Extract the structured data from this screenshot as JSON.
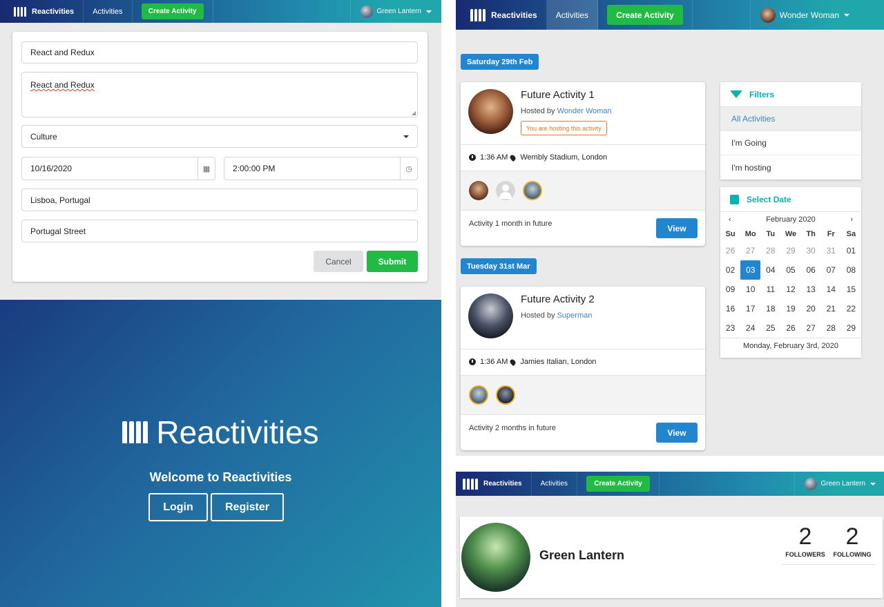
{
  "form_panel": {
    "nav": {
      "brand": "Reactivities",
      "activities": "Activities",
      "create": "Create Activity",
      "user": "Green Lantern"
    },
    "title_value": "React and Redux",
    "description_value": "React and Redux",
    "category_value": "Culture",
    "date_value": "10/16/2020",
    "time_value": "2:00:00 PM",
    "city_value": "Lisboa, Portugal",
    "venue_value": "Portugal Street",
    "cancel_label": "Cancel",
    "submit_label": "Submit"
  },
  "landing_panel": {
    "title": "Reactivities",
    "welcome": "Welcome to Reactivities",
    "login_label": "Login",
    "register_label": "Register"
  },
  "dashboard_panel": {
    "nav": {
      "brand": "Reactivities",
      "activities": "Activities",
      "create": "Create Activity",
      "user": "Wonder Woman"
    },
    "groups": [
      {
        "date": "Saturday 29th Feb",
        "activity": {
          "title": "Future Activity 1",
          "hosted_prefix": "Hosted by",
          "host": "Wonder Woman",
          "badge": "You are hosting this activity",
          "time": "1:36 AM",
          "venue": "Wembly Stadium, London",
          "description": "Activity 1 month in future",
          "view_label": "View"
        }
      },
      {
        "date": "Tuesday 31st Mar",
        "activity": {
          "title": "Future Activity 2",
          "hosted_prefix": "Hosted by",
          "host": "Superman",
          "time": "1:36 AM",
          "venue": "Jamies Italian, London",
          "description": "Activity 2 months in future",
          "view_label": "View"
        }
      }
    ],
    "filters": {
      "title": "Filters",
      "items": [
        "All Activities",
        "I'm Going",
        "I'm hosting"
      ]
    },
    "calendar": {
      "title": "Select Date",
      "month": "February 2020",
      "prev": "‹",
      "next": "›",
      "weekdays": [
        "Su",
        "Mo",
        "Tu",
        "We",
        "Th",
        "Fr",
        "Sa"
      ],
      "weeks": [
        [
          "26",
          "27",
          "28",
          "29",
          "30",
          "31",
          "01"
        ],
        [
          "02",
          "03",
          "04",
          "05",
          "06",
          "07",
          "08"
        ],
        [
          "09",
          "10",
          "11",
          "12",
          "13",
          "14",
          "15"
        ],
        [
          "16",
          "17",
          "18",
          "19",
          "20",
          "21",
          "22"
        ],
        [
          "23",
          "24",
          "25",
          "26",
          "27",
          "28",
          "29"
        ]
      ],
      "selected_label": "Monday, February 3rd, 2020"
    },
    "colors": {
      "accent_blue": "#2185d0",
      "teal": "#00b5ad",
      "hosting_orange": "#f2711c"
    }
  },
  "profile_panel": {
    "nav": {
      "brand": "Reactivities",
      "activities": "Activities",
      "create": "Create Activity",
      "user": "Green Lantern"
    },
    "name": "Green Lantern",
    "followers_count": "2",
    "followers_label": "FOLLOWERS",
    "following_count": "2",
    "following_label": "FOLLOWING"
  }
}
